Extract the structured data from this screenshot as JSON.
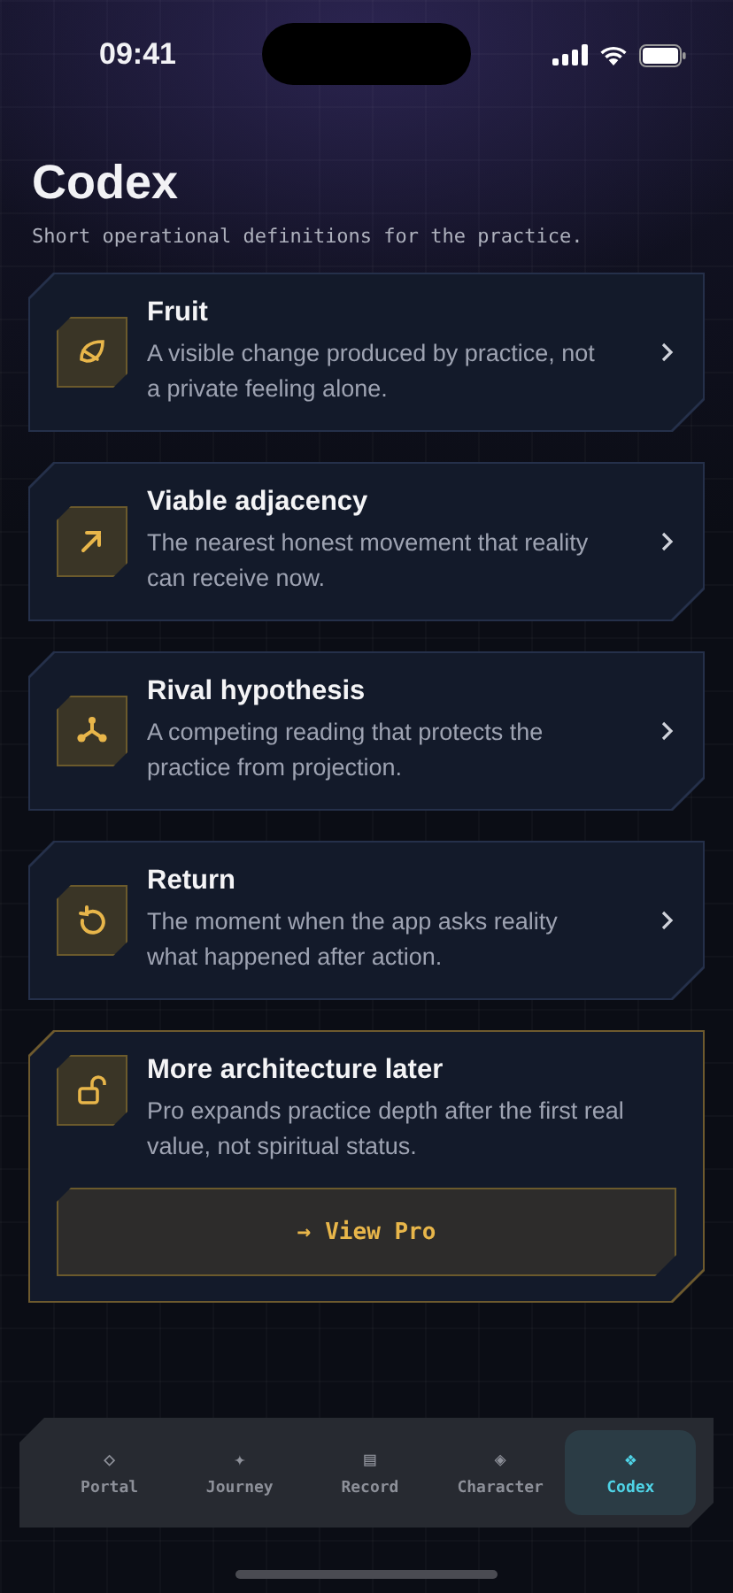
{
  "status_bar": {
    "time": "09:41"
  },
  "header": {
    "title": "Codex",
    "subtitle": "Short operational definitions for the practice."
  },
  "entries": [
    {
      "kind": "leaf",
      "title": "Fruit",
      "description": "A visible change produced by practice, not a private feeling alone."
    },
    {
      "kind": "arrow",
      "title": "Viable adjacency",
      "description": "The nearest honest movement that reality can receive now."
    },
    {
      "kind": "branch",
      "title": "Rival hypothesis",
      "description": "A competing reading that protects the practice from projection."
    },
    {
      "kind": "return",
      "title": "Return",
      "description": "The moment when the app asks reality what happened after action."
    }
  ],
  "pro_card": {
    "title": "More architecture later",
    "description": "Pro expands practice depth after the first real value, not spiritual status.",
    "button": {
      "arrow": "→",
      "label": "View Pro"
    }
  },
  "tabs": [
    {
      "glyph": "◇",
      "label": "Portal",
      "selected": false
    },
    {
      "glyph": "✦",
      "label": "Journey",
      "selected": false
    },
    {
      "glyph": "▤",
      "label": "Record",
      "selected": false
    },
    {
      "glyph": "◈",
      "label": "Character",
      "selected": false
    },
    {
      "glyph": "❖",
      "label": "Codex",
      "selected": true
    }
  ]
}
